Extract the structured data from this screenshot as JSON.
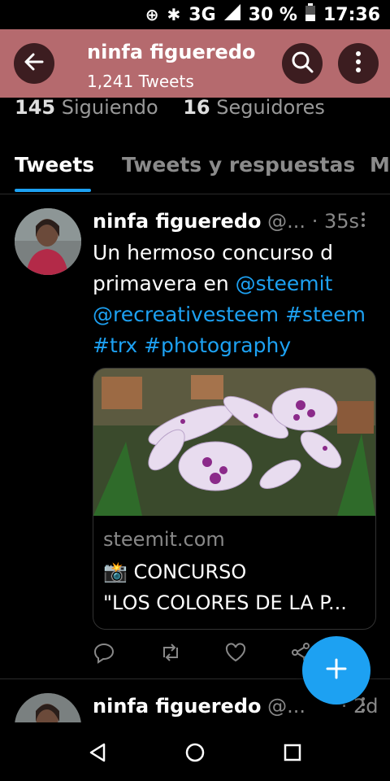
{
  "status": {
    "network": "3G",
    "battery": "30 %",
    "time": "17:36",
    "icons": [
      "data-saver-icon",
      "bluetooth-icon",
      "signal-icon",
      "battery-icon"
    ]
  },
  "header": {
    "title": "ninfa figueredo",
    "subtitle": "1,241 Tweets",
    "icons": [
      "back-arrow-icon",
      "search-icon",
      "more-vertical-icon"
    ],
    "background": "#b56a6e"
  },
  "profile": {
    "following_count": "145",
    "following_label": "Siguiendo",
    "followers_count": "16",
    "followers_label": "Seguidores"
  },
  "tabs": [
    {
      "label": "Tweets",
      "active": true
    },
    {
      "label": "Tweets y respuestas",
      "active": false
    },
    {
      "label": "M",
      "active": false
    }
  ],
  "tweet": {
    "name": "ninfa figueredo",
    "handle": "@...",
    "time": "· 35s",
    "text_plain1": "Un hermoso concurso d",
    "text_plain2": "primavera en ",
    "mention1": "@steemit",
    "mention2": "@recreativesteem",
    "hashtag1": "#steem",
    "hashtag2": "#trx",
    "hashtag3": "#photography",
    "card": {
      "domain": "steemit.com",
      "title_line1": "CONCURSO",
      "title_line2": "\"LOS COLORES DE LA P...",
      "emoji": "📸"
    },
    "actions": [
      "reply-icon",
      "retweet-icon",
      "like-icon",
      "share-icon"
    ]
  },
  "tweet2": {
    "name": "ninfa figueredo",
    "handle": "@...",
    "time": "· 2d"
  },
  "fab": {
    "icon": "plus-icon",
    "color": "#1da1f2"
  },
  "navbar": {
    "icons": [
      "back-triangle-icon",
      "home-circle-icon",
      "recents-square-icon"
    ]
  },
  "colors": {
    "accent": "#1da1f2",
    "muted": "#888888"
  }
}
